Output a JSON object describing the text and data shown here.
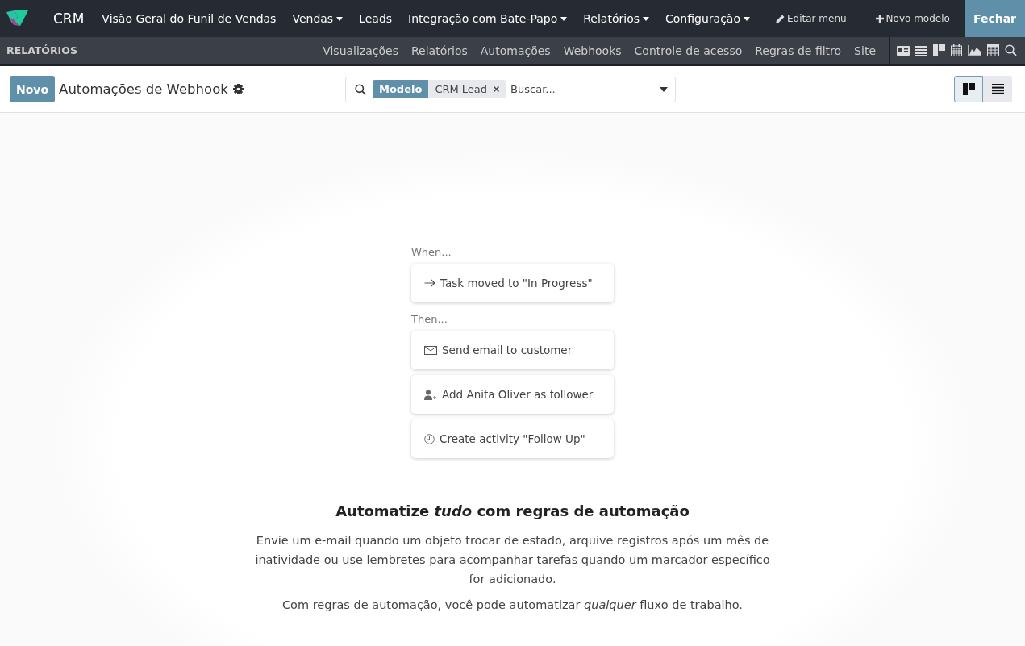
{
  "navbar": {
    "app": "CRM",
    "menus": [
      {
        "label": "Visão Geral do Funil de Vendas",
        "dropdown": false
      },
      {
        "label": "Vendas",
        "dropdown": true
      },
      {
        "label": "Leads",
        "dropdown": false
      },
      {
        "label": "Integração com Bate-Papo",
        "dropdown": true
      },
      {
        "label": "Relatórios",
        "dropdown": true
      },
      {
        "label": "Configuração",
        "dropdown": true
      }
    ],
    "edit_menu": "Editar menu",
    "new_model": "Novo modelo",
    "close": "Fechar"
  },
  "studio_bar": {
    "title": "RELATÓRIOS",
    "links": [
      "Visualizações",
      "Relatórios",
      "Automações",
      "Webhooks",
      "Controle de acesso",
      "Regras de filtro",
      "Site"
    ],
    "view_icons": [
      {
        "kind": "form"
      },
      {
        "kind": "list"
      },
      {
        "kind": "kanban"
      },
      {
        "kind": "calendar"
      },
      {
        "kind": "graph"
      },
      {
        "kind": "pivot"
      },
      {
        "kind": "search"
      }
    ]
  },
  "control_panel": {
    "new_button": "Novo",
    "title": "Automações de Webhook",
    "facet": {
      "label": "Modelo",
      "value": "CRM Lead"
    },
    "search": {
      "placeholder": "Buscar..."
    },
    "views": [
      {
        "kind": "kanban",
        "selected": true
      },
      {
        "kind": "list",
        "selected": false
      }
    ]
  },
  "help": {
    "when": "When...",
    "trigger": {
      "kind": "arrow",
      "text": "Task moved to \"In Progress\""
    },
    "then": "Then...",
    "actions": [
      {
        "kind": "email",
        "text": "Send email to customer"
      },
      {
        "kind": "follower",
        "text": "Add Anita Oliver as follower"
      },
      {
        "kind": "activity",
        "text": "Create activity \"Follow Up\""
      }
    ],
    "title": "Automatize *tudo* com regras de automação",
    "paragraphs": [
      "Envie um e-mail quando um objeto trocar de estado, arquive registros após um mês de inatividade ou use lembretes para acompanhar tarefas quando um marcador específico for adicionado.",
      "Com regras de automação, você pode automatizar *qualquer* fluxo de trabalho."
    ]
  }
}
